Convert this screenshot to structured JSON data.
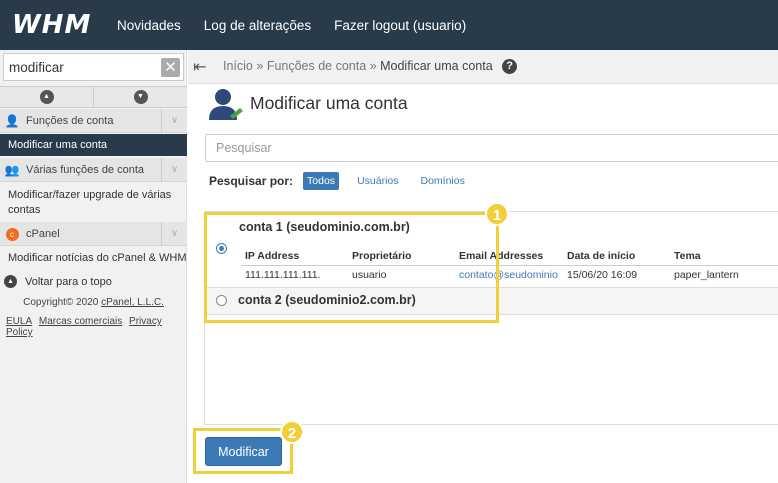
{
  "header": {
    "logo": "WHM",
    "nav": [
      "Novidades",
      "Log de alterações",
      "Fazer logout (usuario)"
    ]
  },
  "sidebar": {
    "search_value": "modificar",
    "categories": [
      {
        "label": "Funções de conta",
        "icon": "user-icon"
      },
      {
        "label": "Várias funções de conta",
        "icon": "users-icon"
      },
      {
        "label": "cPanel",
        "icon": "cpanel-icon"
      }
    ],
    "items": {
      "modify_account": "Modificar uma conta",
      "modify_multi": "Modificar/fazer upgrade de várias contas",
      "cpanel_news": "Modificar notícias do cPanel & WHM"
    },
    "back_to_top": "Voltar para o topo",
    "copyright_prefix": "Copyright© 2020 ",
    "copyright_company": "cPanel, L.L.C.",
    "footer_links": [
      "EULA",
      "Marcas comerciais",
      "Privacy Policy"
    ]
  },
  "breadcrumb": {
    "home": "Início",
    "sep": "»",
    "section": "Funções de conta",
    "current": "Modificar uma conta",
    "help": "?"
  },
  "main": {
    "title": "Modificar uma conta",
    "search_placeholder": "Pesquisar",
    "filter_label": "Pesquisar por:",
    "filters": [
      "Todos",
      "Usuários",
      "Domínios"
    ],
    "accounts": [
      {
        "title": "conta 1 (seudominio.com.br)",
        "selected": true,
        "columns": [
          "IP Address",
          "Proprietário",
          "Email Addresses",
          "Data de início",
          "Tema"
        ],
        "row": [
          "111.111.111.111.",
          "usuario",
          "contato@seudominio",
          "15/06/20 16:09",
          "paper_lantern"
        ]
      },
      {
        "title": "conta 2 (seudominio2.com.br)",
        "selected": false
      }
    ],
    "submit_label": "Modificar"
  },
  "annotations": {
    "badge1": "1",
    "badge2": "2",
    "color": "#f0cf3a"
  },
  "colors": {
    "header_bg": "#293a4a",
    "accent": "#3b7ab5",
    "highlight": "#f0cf3a"
  }
}
